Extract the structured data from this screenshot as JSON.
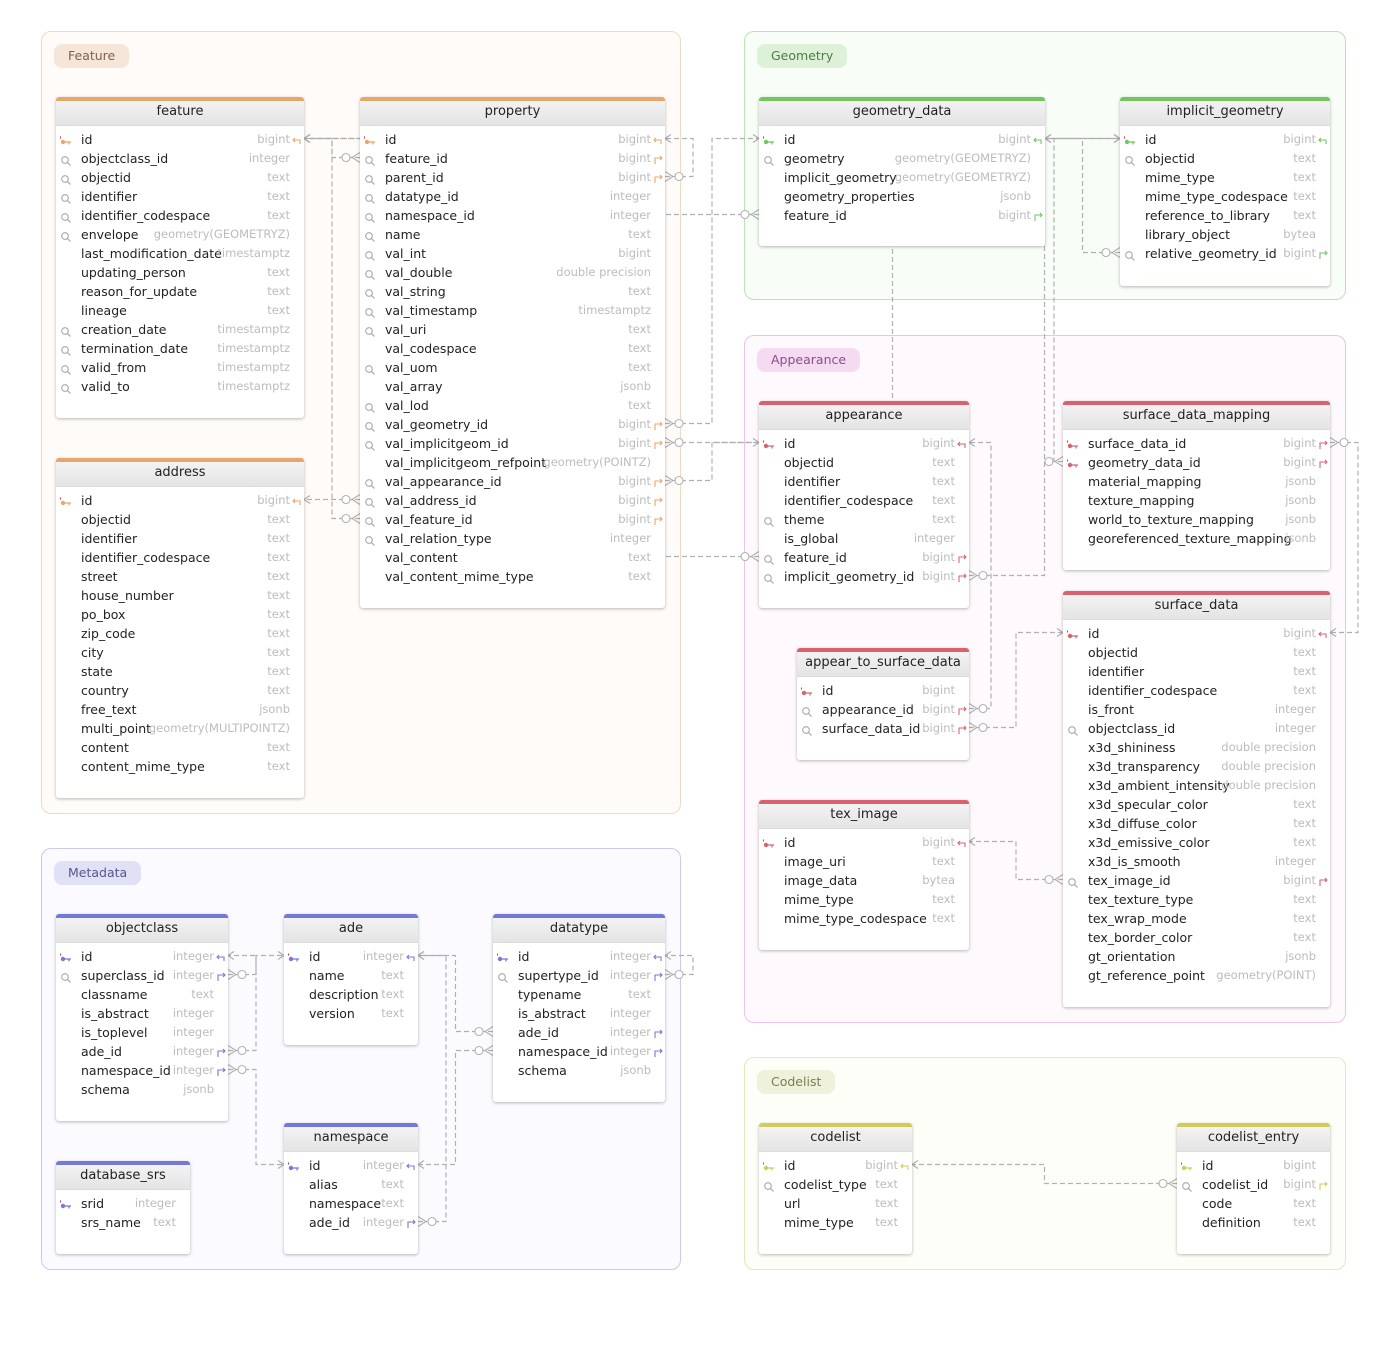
{
  "groups": [
    {
      "id": "feature",
      "label": "Feature",
      "border": "#efd9c4",
      "fill": "#fefbf8",
      "label_bg": "#f5e6d9",
      "label_color": "#7e6252"
    },
    {
      "id": "geometry",
      "label": "Geometry",
      "border": "#b9e4b1",
      "fill": "#f8fdf7",
      "label_bg": "#dcf1d7",
      "label_color": "#4f7d45"
    },
    {
      "id": "appearance",
      "label": "Appearance",
      "border": "#ecc3e9",
      "fill": "#fdf9fd",
      "label_bg": "#f4dbf2",
      "label_color": "#8a4f86"
    },
    {
      "id": "metadata",
      "label": "Metadata",
      "border": "#c9caed",
      "fill": "#fafaff",
      "label_bg": "#e0e1f5",
      "label_color": "#55578f"
    },
    {
      "id": "codelist",
      "label": "Codelist",
      "border": "#e4e7b8",
      "fill": "#fefef9",
      "label_bg": "#eff1da",
      "label_color": "#7b7d50"
    }
  ],
  "colors": {
    "feature": "#e7a66d",
    "geometry": "#72c55f",
    "appearance": "#d8636f",
    "metadata": "#7678d6",
    "codelist": "#cfcc5d",
    "edge": "#b0b0b0"
  },
  "tables": [
    {
      "id": "feature",
      "group": "feature",
      "title": "feature",
      "columns": [
        {
          "name": "id",
          "type": "bigint",
          "icon": "pk",
          "ref": "in"
        },
        {
          "name": "objectclass_id",
          "type": "integer",
          "icon": "idx"
        },
        {
          "name": "objectid",
          "type": "text",
          "icon": "idx"
        },
        {
          "name": "identifier",
          "type": "text",
          "icon": "idx"
        },
        {
          "name": "identifier_codespace",
          "type": "text",
          "icon": "idx"
        },
        {
          "name": "envelope",
          "type": "geometry(GEOMETRYZ)",
          "icon": "idx"
        },
        {
          "name": "last_modification_date",
          "type": "timestamptz"
        },
        {
          "name": "updating_person",
          "type": "text"
        },
        {
          "name": "reason_for_update",
          "type": "text"
        },
        {
          "name": "lineage",
          "type": "text"
        },
        {
          "name": "creation_date",
          "type": "timestamptz",
          "icon": "idx"
        },
        {
          "name": "termination_date",
          "type": "timestamptz",
          "icon": "idx"
        },
        {
          "name": "valid_from",
          "type": "timestamptz",
          "icon": "idx"
        },
        {
          "name": "valid_to",
          "type": "timestamptz",
          "icon": "idx"
        }
      ]
    },
    {
      "id": "address",
      "group": "feature",
      "title": "address",
      "columns": [
        {
          "name": "id",
          "type": "bigint",
          "icon": "pk",
          "ref": "in"
        },
        {
          "name": "objectid",
          "type": "text"
        },
        {
          "name": "identifier",
          "type": "text"
        },
        {
          "name": "identifier_codespace",
          "type": "text"
        },
        {
          "name": "street",
          "type": "text"
        },
        {
          "name": "house_number",
          "type": "text"
        },
        {
          "name": "po_box",
          "type": "text"
        },
        {
          "name": "zip_code",
          "type": "text"
        },
        {
          "name": "city",
          "type": "text"
        },
        {
          "name": "state",
          "type": "text"
        },
        {
          "name": "country",
          "type": "text"
        },
        {
          "name": "free_text",
          "type": "jsonb"
        },
        {
          "name": "multi_point",
          "type": "geometry(MULTIPOINTZ)"
        },
        {
          "name": "content",
          "type": "text"
        },
        {
          "name": "content_mime_type",
          "type": "text"
        }
      ]
    },
    {
      "id": "property",
      "group": "feature",
      "title": "property",
      "columns": [
        {
          "name": "id",
          "type": "bigint",
          "icon": "pk",
          "ref": "in"
        },
        {
          "name": "feature_id",
          "type": "bigint",
          "icon": "idx",
          "ref": "out"
        },
        {
          "name": "parent_id",
          "type": "bigint",
          "icon": "idx",
          "ref": "out"
        },
        {
          "name": "datatype_id",
          "type": "integer",
          "icon": "idx"
        },
        {
          "name": "namespace_id",
          "type": "integer",
          "icon": "idx"
        },
        {
          "name": "name",
          "type": "text",
          "icon": "idx"
        },
        {
          "name": "val_int",
          "type": "bigint",
          "icon": "idx"
        },
        {
          "name": "val_double",
          "type": "double precision",
          "icon": "idx"
        },
        {
          "name": "val_string",
          "type": "text",
          "icon": "idx"
        },
        {
          "name": "val_timestamp",
          "type": "timestamptz",
          "icon": "idx"
        },
        {
          "name": "val_uri",
          "type": "text",
          "icon": "idx"
        },
        {
          "name": "val_codespace",
          "type": "text"
        },
        {
          "name": "val_uom",
          "type": "text",
          "icon": "idx"
        },
        {
          "name": "val_array",
          "type": "jsonb"
        },
        {
          "name": "val_lod",
          "type": "text",
          "icon": "idx"
        },
        {
          "name": "val_geometry_id",
          "type": "bigint",
          "icon": "idx",
          "ref": "out"
        },
        {
          "name": "val_implicitgeom_id",
          "type": "bigint",
          "icon": "idx",
          "ref": "out"
        },
        {
          "name": "val_implicitgeom_refpoint",
          "type": "geometry(POINTZ)"
        },
        {
          "name": "val_appearance_id",
          "type": "bigint",
          "icon": "idx",
          "ref": "out"
        },
        {
          "name": "val_address_id",
          "type": "bigint",
          "icon": "idx",
          "ref": "out"
        },
        {
          "name": "val_feature_id",
          "type": "bigint",
          "icon": "idx",
          "ref": "out"
        },
        {
          "name": "val_relation_type",
          "type": "integer",
          "icon": "idx"
        },
        {
          "name": "val_content",
          "type": "text"
        },
        {
          "name": "val_content_mime_type",
          "type": "text"
        }
      ]
    },
    {
      "id": "geometry_data",
      "group": "geometry",
      "title": "geometry_data",
      "columns": [
        {
          "name": "id",
          "type": "bigint",
          "icon": "pk",
          "ref": "in"
        },
        {
          "name": "geometry",
          "type": "geometry(GEOMETRYZ)",
          "icon": "idx"
        },
        {
          "name": "implicit_geometry",
          "type": "geometry(GEOMETRYZ)"
        },
        {
          "name": "geometry_properties",
          "type": "jsonb"
        },
        {
          "name": "feature_id",
          "type": "bigint",
          "ref": "out"
        }
      ]
    },
    {
      "id": "implicit_geometry",
      "group": "geometry",
      "title": "implicit_geometry",
      "columns": [
        {
          "name": "id",
          "type": "bigint",
          "icon": "pk",
          "ref": "in"
        },
        {
          "name": "objectid",
          "type": "text",
          "icon": "idx"
        },
        {
          "name": "mime_type",
          "type": "text"
        },
        {
          "name": "mime_type_codespace",
          "type": "text"
        },
        {
          "name": "reference_to_library",
          "type": "text"
        },
        {
          "name": "library_object",
          "type": "bytea"
        },
        {
          "name": "relative_geometry_id",
          "type": "bigint",
          "icon": "idx",
          "ref": "out"
        }
      ]
    },
    {
      "id": "appearance",
      "group": "appearance",
      "title": "appearance",
      "columns": [
        {
          "name": "id",
          "type": "bigint",
          "icon": "pk",
          "ref": "in"
        },
        {
          "name": "objectid",
          "type": "text"
        },
        {
          "name": "identifier",
          "type": "text"
        },
        {
          "name": "identifier_codespace",
          "type": "text"
        },
        {
          "name": "theme",
          "type": "text",
          "icon": "idx"
        },
        {
          "name": "is_global",
          "type": "integer"
        },
        {
          "name": "feature_id",
          "type": "bigint",
          "icon": "idx",
          "ref": "out"
        },
        {
          "name": "implicit_geometry_id",
          "type": "bigint",
          "icon": "idx",
          "ref": "out"
        }
      ]
    },
    {
      "id": "surface_data_mapping",
      "group": "appearance",
      "title": "surface_data_mapping",
      "columns": [
        {
          "name": "surface_data_id",
          "type": "bigint",
          "icon": "pk",
          "ref": "out"
        },
        {
          "name": "geometry_data_id",
          "type": "bigint",
          "icon": "pk",
          "ref": "out"
        },
        {
          "name": "material_mapping",
          "type": "jsonb"
        },
        {
          "name": "texture_mapping",
          "type": "jsonb"
        },
        {
          "name": "world_to_texture_mapping",
          "type": "jsonb"
        },
        {
          "name": "georeferenced_texture_mapping",
          "type": "jsonb"
        }
      ]
    },
    {
      "id": "appear_to_surface_data",
      "group": "appearance",
      "title": "appear_to_surface_data",
      "columns": [
        {
          "name": "id",
          "type": "bigint",
          "icon": "pk"
        },
        {
          "name": "appearance_id",
          "type": "bigint",
          "icon": "idx",
          "ref": "out"
        },
        {
          "name": "surface_data_id",
          "type": "bigint",
          "icon": "idx",
          "ref": "out"
        }
      ]
    },
    {
      "id": "surface_data",
      "group": "appearance",
      "title": "surface_data",
      "columns": [
        {
          "name": "id",
          "type": "bigint",
          "icon": "pk",
          "ref": "in"
        },
        {
          "name": "objectid",
          "type": "text"
        },
        {
          "name": "identifier",
          "type": "text"
        },
        {
          "name": "identifier_codespace",
          "type": "text"
        },
        {
          "name": "is_front",
          "type": "integer"
        },
        {
          "name": "objectclass_id",
          "type": "integer",
          "icon": "idx"
        },
        {
          "name": "x3d_shininess",
          "type": "double precision"
        },
        {
          "name": "x3d_transparency",
          "type": "double precision"
        },
        {
          "name": "x3d_ambient_intensity",
          "type": "double precision"
        },
        {
          "name": "x3d_specular_color",
          "type": "text"
        },
        {
          "name": "x3d_diffuse_color",
          "type": "text"
        },
        {
          "name": "x3d_emissive_color",
          "type": "text"
        },
        {
          "name": "x3d_is_smooth",
          "type": "integer"
        },
        {
          "name": "tex_image_id",
          "type": "bigint",
          "icon": "idx",
          "ref": "out"
        },
        {
          "name": "tex_texture_type",
          "type": "text"
        },
        {
          "name": "tex_wrap_mode",
          "type": "text"
        },
        {
          "name": "tex_border_color",
          "type": "text"
        },
        {
          "name": "gt_orientation",
          "type": "jsonb"
        },
        {
          "name": "gt_reference_point",
          "type": "geometry(POINT)"
        }
      ]
    },
    {
      "id": "tex_image",
      "group": "appearance",
      "title": "tex_image",
      "columns": [
        {
          "name": "id",
          "type": "bigint",
          "icon": "pk",
          "ref": "in"
        },
        {
          "name": "image_uri",
          "type": "text"
        },
        {
          "name": "image_data",
          "type": "bytea"
        },
        {
          "name": "mime_type",
          "type": "text"
        },
        {
          "name": "mime_type_codespace",
          "type": "text"
        }
      ]
    },
    {
      "id": "objectclass",
      "group": "metadata",
      "title": "objectclass",
      "columns": [
        {
          "name": "id",
          "type": "integer",
          "icon": "pk",
          "ref": "in"
        },
        {
          "name": "superclass_id",
          "type": "integer",
          "icon": "idx",
          "ref": "out"
        },
        {
          "name": "classname",
          "type": "text"
        },
        {
          "name": "is_abstract",
          "type": "integer"
        },
        {
          "name": "is_toplevel",
          "type": "integer"
        },
        {
          "name": "ade_id",
          "type": "integer",
          "ref": "out"
        },
        {
          "name": "namespace_id",
          "type": "integer",
          "ref": "out"
        },
        {
          "name": "schema",
          "type": "jsonb"
        }
      ]
    },
    {
      "id": "ade",
      "group": "metadata",
      "title": "ade",
      "columns": [
        {
          "name": "id",
          "type": "integer",
          "icon": "pk",
          "ref": "in"
        },
        {
          "name": "name",
          "type": "text"
        },
        {
          "name": "description",
          "type": "text"
        },
        {
          "name": "version",
          "type": "text"
        }
      ]
    },
    {
      "id": "datatype",
      "group": "metadata",
      "title": "datatype",
      "columns": [
        {
          "name": "id",
          "type": "integer",
          "icon": "pk",
          "ref": "in"
        },
        {
          "name": "supertype_id",
          "type": "integer",
          "icon": "idx",
          "ref": "out"
        },
        {
          "name": "typename",
          "type": "text"
        },
        {
          "name": "is_abstract",
          "type": "integer"
        },
        {
          "name": "ade_id",
          "type": "integer",
          "ref": "out"
        },
        {
          "name": "namespace_id",
          "type": "integer",
          "ref": "out"
        },
        {
          "name": "schema",
          "type": "jsonb"
        }
      ]
    },
    {
      "id": "database_srs",
      "group": "metadata",
      "title": "database_srs",
      "columns": [
        {
          "name": "srid",
          "type": "integer",
          "icon": "pk"
        },
        {
          "name": "srs_name",
          "type": "text"
        }
      ]
    },
    {
      "id": "namespace",
      "group": "metadata",
      "title": "namespace",
      "columns": [
        {
          "name": "id",
          "type": "integer",
          "icon": "pk",
          "ref": "in"
        },
        {
          "name": "alias",
          "type": "text"
        },
        {
          "name": "namespace",
          "type": "text"
        },
        {
          "name": "ade_id",
          "type": "integer",
          "ref": "out"
        }
      ]
    },
    {
      "id": "codelist",
      "group": "codelist",
      "title": "codelist",
      "columns": [
        {
          "name": "id",
          "type": "bigint",
          "icon": "pk",
          "ref": "in"
        },
        {
          "name": "codelist_type",
          "type": "text",
          "icon": "idx"
        },
        {
          "name": "url",
          "type": "text"
        },
        {
          "name": "mime_type",
          "type": "text"
        }
      ]
    },
    {
      "id": "codelist_entry",
      "group": "codelist",
      "title": "codelist_entry",
      "columns": [
        {
          "name": "id",
          "type": "bigint",
          "icon": "pk"
        },
        {
          "name": "codelist_id",
          "type": "bigint",
          "icon": "idx",
          "ref": "out"
        },
        {
          "name": "code",
          "type": "text"
        },
        {
          "name": "definition",
          "type": "text"
        }
      ]
    }
  ],
  "relations": [
    {
      "from": "property.feature_id",
      "to": "feature.id"
    },
    {
      "from": "property.parent_id",
      "to": "property.id"
    },
    {
      "from": "property.val_address_id",
      "to": "address.id"
    },
    {
      "from": "property.val_feature_id",
      "to": "feature.id"
    },
    {
      "from": "property.val_geometry_id",
      "to": "geometry_data.id"
    },
    {
      "from": "property.val_implicitgeom_id",
      "to": "implicit_geometry.id"
    },
    {
      "from": "property.val_appearance_id",
      "to": "appearance.id"
    },
    {
      "from": "geometry_data.feature_id",
      "to": "feature.id"
    },
    {
      "from": "implicit_geometry.relative_geometry_id",
      "to": "geometry_data.id"
    },
    {
      "from": "appearance.feature_id",
      "to": "feature.id"
    },
    {
      "from": "appearance.implicit_geometry_id",
      "to": "implicit_geometry.id"
    },
    {
      "from": "surface_data_mapping.surface_data_id",
      "to": "surface_data.id"
    },
    {
      "from": "surface_data_mapping.geometry_data_id",
      "to": "geometry_data.id"
    },
    {
      "from": "appear_to_surface_data.appearance_id",
      "to": "appearance.id"
    },
    {
      "from": "appear_to_surface_data.surface_data_id",
      "to": "surface_data.id"
    },
    {
      "from": "surface_data.tex_image_id",
      "to": "tex_image.id"
    },
    {
      "from": "objectclass.superclass_id",
      "to": "objectclass.id"
    },
    {
      "from": "objectclass.ade_id",
      "to": "ade.id"
    },
    {
      "from": "objectclass.namespace_id",
      "to": "namespace.id"
    },
    {
      "from": "datatype.supertype_id",
      "to": "datatype.id"
    },
    {
      "from": "datatype.ade_id",
      "to": "ade.id"
    },
    {
      "from": "datatype.namespace_id",
      "to": "namespace.id"
    },
    {
      "from": "namespace.ade_id",
      "to": "ade.id"
    },
    {
      "from": "codelist_entry.codelist_id",
      "to": "codelist.id"
    }
  ]
}
